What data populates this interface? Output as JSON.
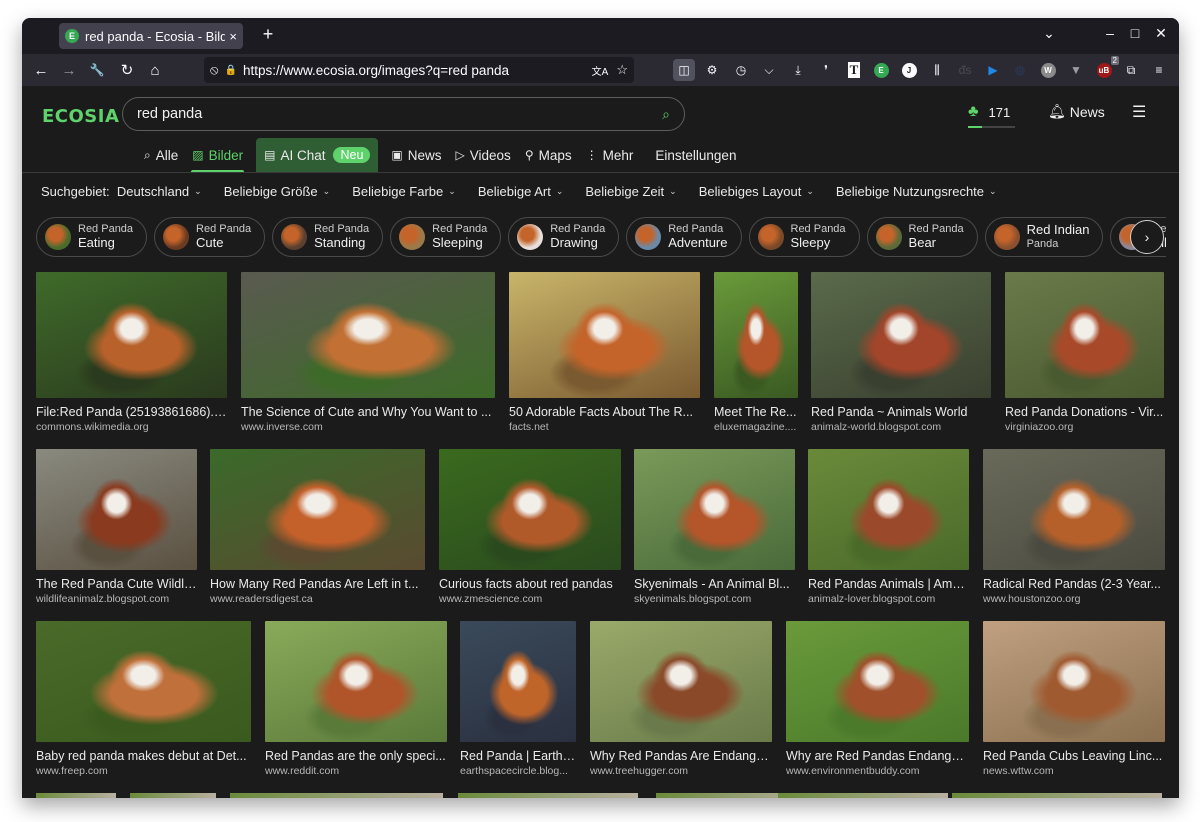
{
  "browser": {
    "tab_title": "red panda - Ecosia - Bilder",
    "tab_close": "×",
    "new_tab": "+",
    "url": "https://www.ecosia.org/images?q=red panda",
    "window_controls": {
      "list_all_tabs": "⌄",
      "minimize": "–",
      "maximize": "□",
      "close": "✕"
    },
    "nav": {
      "back": "←",
      "forward": "→",
      "tools": "🔧",
      "reload": "↻",
      "home": "⌂"
    },
    "url_icons": {
      "tracking": "⦸",
      "lock": "🔒",
      "translate": "文A",
      "bookmark": "☆"
    },
    "extensions": [
      {
        "name": "sidebar-icon",
        "glyph": "◫",
        "active": true
      },
      {
        "name": "settings-gear-icon",
        "glyph": "⚙"
      },
      {
        "name": "history-clock-icon",
        "glyph": "◷"
      },
      {
        "name": "pocket-icon",
        "glyph": "⌵"
      },
      {
        "name": "downloads-icon",
        "glyph": "⤓"
      },
      {
        "name": "gnome-foot-icon",
        "glyph": "❜"
      },
      {
        "name": "reader-t-icon",
        "glyph": "T"
      },
      {
        "name": "ecosia-e-icon",
        "glyph": "E"
      },
      {
        "name": "j-circle-icon",
        "glyph": "J"
      },
      {
        "name": "fence-icon",
        "glyph": "⫼"
      },
      {
        "name": "ds-icon",
        "glyph": "ᵭs"
      },
      {
        "name": "play-icon",
        "glyph": "▶"
      },
      {
        "name": "globe-grid-icon",
        "glyph": "◍"
      },
      {
        "name": "w-circle-icon",
        "glyph": "W"
      },
      {
        "name": "v-icon",
        "glyph": "▼"
      },
      {
        "name": "ublock-icon",
        "glyph": "uB",
        "badge": "2"
      },
      {
        "name": "extensions-puzzle-icon",
        "glyph": "⧉"
      },
      {
        "name": "app-menu-icon",
        "glyph": "≡"
      }
    ]
  },
  "ecosia": {
    "logo": "ECOSIA",
    "search_query": "red panda",
    "search_icon": "⌕",
    "tree_count": "171",
    "tree_progress": 0.3,
    "news_label": "News",
    "menu_icon": "☰",
    "accent": "#5ed26b",
    "tabs": [
      {
        "id": "alle",
        "icon": "⌕",
        "label": "Alle"
      },
      {
        "id": "bilder",
        "icon": "▨",
        "label": "Bilder",
        "active": true
      },
      {
        "id": "aichat",
        "icon": "▤",
        "label": "AI Chat",
        "badge": "Neu"
      },
      {
        "id": "news",
        "icon": "▣",
        "label": "News"
      },
      {
        "id": "videos",
        "icon": "▷",
        "label": "Videos"
      },
      {
        "id": "maps",
        "icon": "⚲",
        "label": "Maps"
      },
      {
        "id": "mehr",
        "icon": "⋮",
        "label": "Mehr"
      },
      {
        "id": "einstellungen",
        "icon": "",
        "label": "Einstellungen"
      }
    ],
    "filters": [
      {
        "label": "Suchgebiet:  Deutschland"
      },
      {
        "label": "Beliebige Größe"
      },
      {
        "label": "Beliebige Farbe"
      },
      {
        "label": "Beliebige Art"
      },
      {
        "label": "Beliebige Zeit"
      },
      {
        "label": "Beliebiges Layout"
      },
      {
        "label": "Beliebige Nutzungsrechte"
      }
    ],
    "chips": [
      {
        "line1": "Red Panda",
        "line2": "Eating",
        "color": "#4a6b2c"
      },
      {
        "line1": "Red Panda",
        "line2": "Cute",
        "color": "#6b3a22"
      },
      {
        "line1": "Red Panda",
        "line2": "Standing",
        "color": "#5a4030"
      },
      {
        "line1": "Red Panda",
        "line2": "Sleeping",
        "color": "#9a7a4a"
      },
      {
        "line1": "Red Panda",
        "line2": "Drawing",
        "color": "#e8e0dc"
      },
      {
        "line1": "Red Panda",
        "line2": "Adventure",
        "color": "#6a8aa8"
      },
      {
        "line1": "Red Panda",
        "line2": "Sleepy",
        "color": "#7a4a28"
      },
      {
        "line1": "Red Panda",
        "line2": "Bear",
        "color": "#5a6a3a"
      },
      {
        "line1": "Red Indian",
        "line2": "Panda",
        "color": "#8a5030",
        "inverted": true
      },
      {
        "line1": "Red Panda",
        "line2": "Bilder",
        "color": "#8a8a9a"
      }
    ],
    "chip_next": "›",
    "results": [
      {
        "title": "File:Red Panda (25193861686).j...",
        "source": "commons.wikimedia.org",
        "colors": [
          "#3f6a2a",
          "#b8612a",
          "#2a3a1e"
        ]
      },
      {
        "title": "The Science of Cute and Why You Want to ...",
        "source": "www.inverse.com",
        "colors": [
          "#5a5a50",
          "#c27033",
          "#3d6a28"
        ]
      },
      {
        "title": "50 Adorable Facts About The R...",
        "source": "facts.net",
        "colors": [
          "#c9b56a",
          "#c4642a",
          "#7a5a30"
        ]
      },
      {
        "title": "Meet The Re...",
        "source": "eluxemagazine....",
        "colors": [
          "#6a9a3a",
          "#b5552a",
          "#3a5a22"
        ]
      },
      {
        "title": "Red Panda ~ Animals World",
        "source": "animalz-world.blogspot.com",
        "colors": [
          "#5a6a4a",
          "#a2452a",
          "#3a4030"
        ]
      },
      {
        "title": "Red Panda Donations - Vir...",
        "source": "virginiazoo.org",
        "colors": [
          "#6a7a4a",
          "#a84a2a",
          "#4a5a30"
        ]
      },
      {
        "title": "The Red Panda Cute Wildli...",
        "source": "wildlifeanimalz.blogspot.com",
        "colors": [
          "#8a8a80",
          "#8a3a1e",
          "#5a5040"
        ]
      },
      {
        "title": "How Many Red Pandas Are Left in t...",
        "source": "www.readersdigest.ca",
        "colors": [
          "#3a6a2a",
          "#c4602a",
          "#5a4a30"
        ]
      },
      {
        "title": "Curious facts about red pandas",
        "source": "www.zmescience.com",
        "colors": [
          "#3a6a1e",
          "#b05a2a",
          "#2a4a1e"
        ]
      },
      {
        "title": "Skyenimals - An Animal Bl...",
        "source": "skyenimals.blogspot.com",
        "colors": [
          "#7a9a5a",
          "#b4552a",
          "#4a6a3a"
        ]
      },
      {
        "title": "Red Pandas Animals | Ama...",
        "source": "animalz-lover.blogspot.com",
        "colors": [
          "#6a8a3a",
          "#9a4a2a",
          "#4a6a2a"
        ]
      },
      {
        "title": "Radical Red Pandas (2-3 Year...",
        "source": "www.houstonzoo.org",
        "colors": [
          "#6a6a5a",
          "#b5602a",
          "#4a4a40"
        ]
      },
      {
        "title": "Baby red panda makes debut at Det...",
        "source": "www.freep.com",
        "colors": [
          "#4a6a2a",
          "#c0703a",
          "#3a5a1e"
        ]
      },
      {
        "title": "Red Pandas are the only speci...",
        "source": "www.reddit.com",
        "colors": [
          "#8aaa5a",
          "#b0552a",
          "#5a7a3a"
        ]
      },
      {
        "title": "Red Panda | Earth ...",
        "source": "earthspacecircle.blog...",
        "colors": [
          "#3a4a5a",
          "#c0652a",
          "#2a3040"
        ]
      },
      {
        "title": "Why Red Pandas Are Endange...",
        "source": "www.treehugger.com",
        "colors": [
          "#9aaa6a",
          "#8a4a2a",
          "#6a7a4a"
        ]
      },
      {
        "title": "Why are Red Pandas Endanger...",
        "source": "www.environmentbuddy.com",
        "colors": [
          "#6a9a3a",
          "#a0502a",
          "#4a7a2a"
        ]
      },
      {
        "title": "Red Panda Cubs Leaving Linc...",
        "source": "news.wttw.com",
        "colors": [
          "#c0a080",
          "#a05a30",
          "#8a7050"
        ]
      }
    ]
  }
}
